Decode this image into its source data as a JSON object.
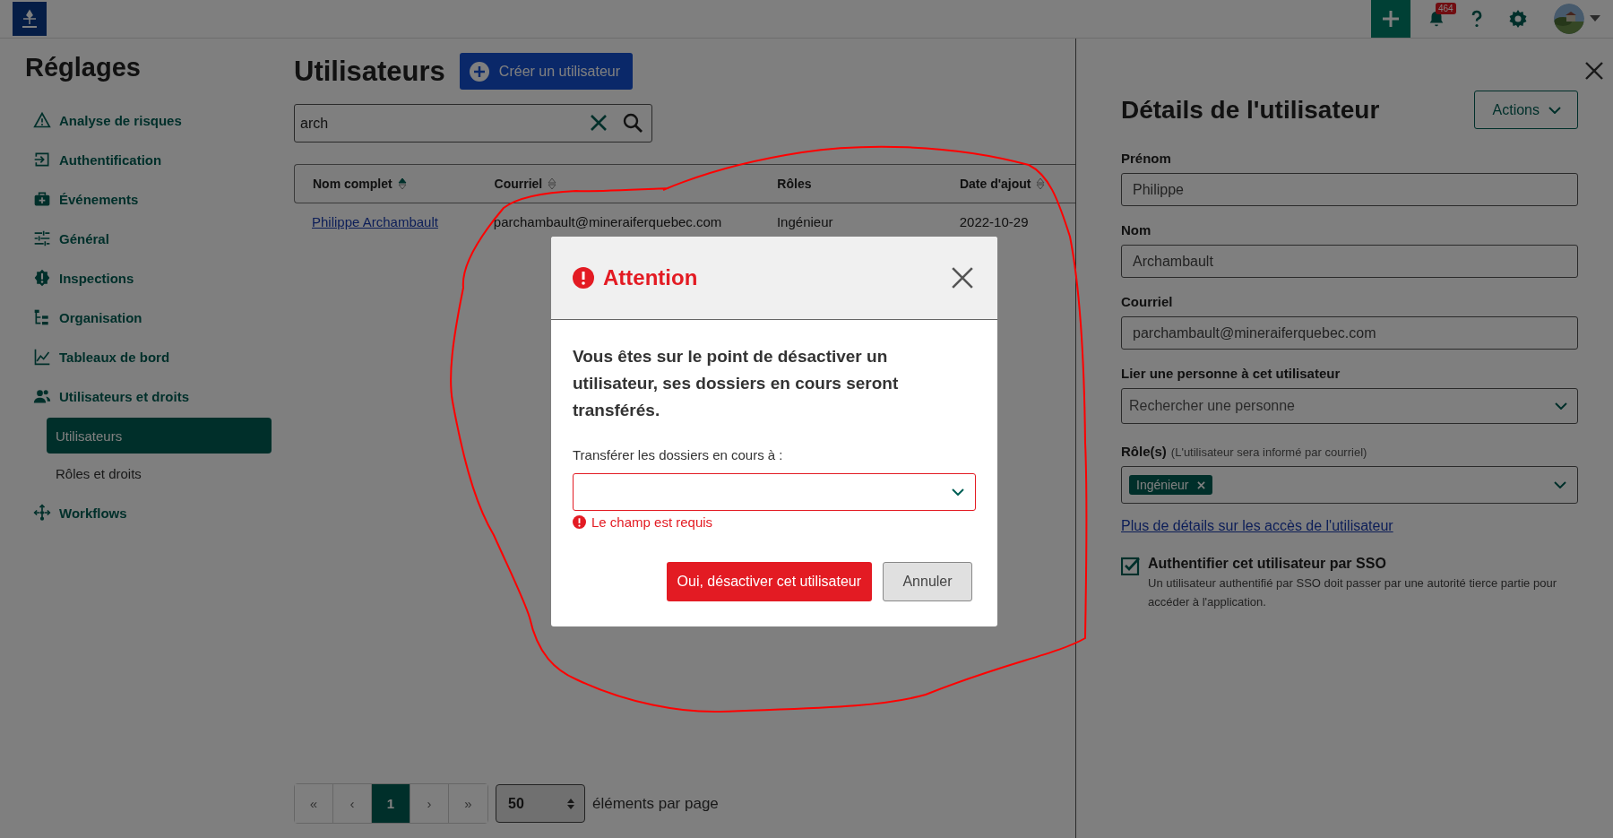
{
  "topbar": {
    "notifications_badge": "464"
  },
  "sidebar": {
    "title": "Réglages",
    "items": [
      {
        "label": "Analyse de risques",
        "selected": false
      },
      {
        "label": "Authentification",
        "selected": false
      },
      {
        "label": "Événements",
        "selected": false
      },
      {
        "label": "Général",
        "selected": false
      },
      {
        "label": "Inspections",
        "selected": false
      },
      {
        "label": "Organisation",
        "selected": false
      },
      {
        "label": "Tableaux de bord",
        "selected": false
      },
      {
        "label": "Utilisateurs et droits",
        "selected": false,
        "children": [
          {
            "label": "Utilisateurs",
            "selected": true
          },
          {
            "label": "Rôles et droits",
            "selected": false
          }
        ]
      },
      {
        "label": "Workflows",
        "selected": false
      }
    ]
  },
  "main": {
    "title": "Utilisateurs",
    "create_button": "Créer un utilisateur",
    "search": {
      "value": "arch"
    },
    "table": {
      "columns": [
        {
          "label": "Nom complet",
          "sortable": true,
          "sorted": true
        },
        {
          "label": "Courriel",
          "sortable": true,
          "sorted": false
        },
        {
          "label": "Rôles",
          "sortable": false
        },
        {
          "label": "Date d'ajout",
          "sortable": true,
          "sorted": false
        }
      ],
      "rows": [
        {
          "cells": [
            "Philippe Archambault",
            "parchambault@mineraiferquebec.com",
            "Ingénieur",
            "2022-10-29"
          ]
        }
      ]
    },
    "pagination": {
      "pages": [
        {
          "label": "«",
          "selected": false
        },
        {
          "label": "‹",
          "selected": false
        },
        {
          "label": "1",
          "selected": true
        },
        {
          "label": "›",
          "selected": false
        },
        {
          "label": "»",
          "selected": false
        }
      ],
      "per_page": "50",
      "per_page_label": "éléments par page"
    }
  },
  "details": {
    "title": "Détails de l'utilisateur",
    "actions_button": "Actions",
    "fields": [
      {
        "label": "Prénom",
        "value": "Philippe"
      },
      {
        "label": "Nom",
        "value": "Archambault"
      },
      {
        "label": "Courriel",
        "value": "parchambault@mineraiferquebec.com"
      }
    ],
    "person": {
      "label": "Lier une personne à cet utilisateur",
      "placeholder": "Rechercher une personne"
    },
    "roles": {
      "label": "Rôle(s)",
      "hint": "(L'utilisateur sera informé par courriel)",
      "tags": [
        "Ingénieur"
      ]
    },
    "link": "Plus de détails sur les accès de l'utilisateur",
    "sso": {
      "label": "Authentifier cet utilisateur par SSO",
      "checked": true,
      "description": "Un utilisateur authentifié par SSO doit passer par une autorité tierce partie pour accéder à l'application."
    }
  },
  "modal": {
    "title": "Attention",
    "message": "Vous êtes sur le point de désactiver un utilisateur, ses dossiers en cours seront transférés.",
    "field_label": "Transférer les dossiers en cours à :",
    "error": "Le champ est requis",
    "buttons": [
      {
        "label": "Oui, désactiver cet utilisateur",
        "kind": "danger"
      },
      {
        "label": "Annuler",
        "kind": "secondary"
      }
    ]
  },
  "annotations": [
    {
      "kind": "loop"
    }
  ]
}
